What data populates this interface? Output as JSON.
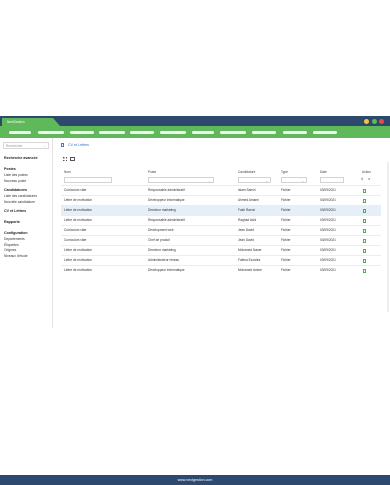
{
  "app": {
    "tab_label": "NextGestion"
  },
  "window_controls": [
    {
      "name": "minimize",
      "color": "#f5c04a"
    },
    {
      "name": "maximize",
      "color": "#5fb85a"
    },
    {
      "name": "close",
      "color": "#e0533e"
    }
  ],
  "sidebar": {
    "search_placeholder": "Rechercher",
    "sections": [
      {
        "title": "Recherche avancée",
        "items": []
      },
      {
        "title": "Postes",
        "items": [
          "Liste des postes",
          "Nouveau poste"
        ]
      },
      {
        "title": "Candidatures",
        "items": [
          "Liste des candidatures",
          "Nouvelle candidature"
        ]
      },
      {
        "title": "CV et Lettres",
        "items": []
      },
      {
        "title": "Rapports",
        "items": []
      },
      {
        "title": "Configuration",
        "items": [
          "Departements",
          "Étiquettes",
          "Origines",
          "Niveaux d'étude"
        ]
      }
    ]
  },
  "breadcrumb": {
    "label": "CV et Lettres"
  },
  "table": {
    "columns": [
      "Nom",
      "Poste",
      "Candidature",
      "Type",
      "Date",
      "Action"
    ],
    "rows": [
      {
        "nom": "Curriculum vitæ",
        "poste": "Responsable administratif",
        "candidature": "Islam Samiri",
        "type": "Fichier",
        "date": "03/09/2021",
        "highlight": false
      },
      {
        "nom": "Lettre de motivation",
        "poste": "Développeur informatique",
        "candidature": "Ahmed Amami",
        "type": "Fichier",
        "date": "03/09/2021",
        "highlight": false
      },
      {
        "nom": "Lettre de motivation",
        "poste": "Directeur marketing",
        "candidature": "Fakir Ramzi",
        "type": "Fichier",
        "date": "03/09/2021",
        "highlight": true
      },
      {
        "nom": "Lettre de motivation",
        "poste": "Responsable administratif",
        "candidature": "Raghad Ashi",
        "type": "Fichier",
        "date": "03/09/2021",
        "highlight": false
      },
      {
        "nom": "Curriculum vitæ",
        "poste": "Development web",
        "candidature": "Jean David",
        "type": "Fichier",
        "date": "03/09/2021",
        "highlight": false
      },
      {
        "nom": "Curriculum vitæ",
        "poste": "Chef de produit",
        "candidature": "Jean David",
        "type": "Fichier",
        "date": "03/09/2021",
        "highlight": false
      },
      {
        "nom": "Lettre de motivation",
        "poste": "Directeur marketing",
        "candidature": "Mohamed Naser",
        "type": "Fichier",
        "date": "03/09/2021",
        "highlight": false
      },
      {
        "nom": "Lettre de motivation",
        "poste": "Administrateur réseau",
        "candidature": "Fatima Ezzahra",
        "type": "Fichier",
        "date": "03/09/2021",
        "highlight": false
      },
      {
        "nom": "Lettre de motivation",
        "poste": "Développeur informatique",
        "candidature": "Mohamed Amine",
        "type": "Fichier",
        "date": "03/09/2021",
        "highlight": false
      }
    ]
  },
  "footer": {
    "text": "www.nextgestion.com"
  }
}
